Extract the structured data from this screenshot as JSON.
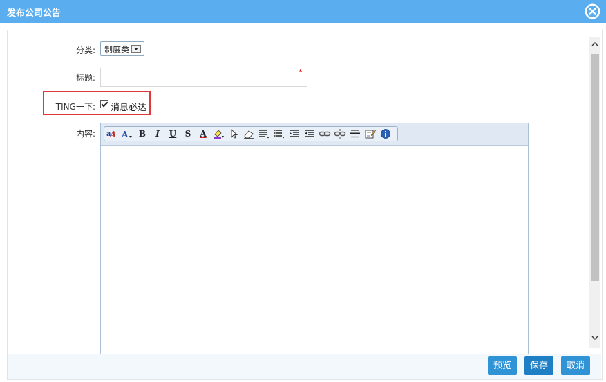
{
  "dialog": {
    "title": "发布公司公告"
  },
  "form": {
    "category_label": "分类:",
    "category_value": "制度类",
    "title_label": "标题:",
    "title_value": "",
    "required_mark": "*",
    "ting_label": "TING一下:",
    "ting_checkbox_label": "消息必达",
    "ting_checked": true,
    "content_label": "内容:"
  },
  "toolbar": {
    "bold": "B",
    "italic": "I",
    "underline": "U",
    "strike": "S",
    "font_color": "A"
  },
  "buttons": {
    "preview": "预览",
    "save": "保存",
    "cancel": "取消"
  },
  "colors": {
    "titlebar": "#5aaef0",
    "primary_button": "#2f93d6",
    "highlight_border": "#e03838"
  }
}
